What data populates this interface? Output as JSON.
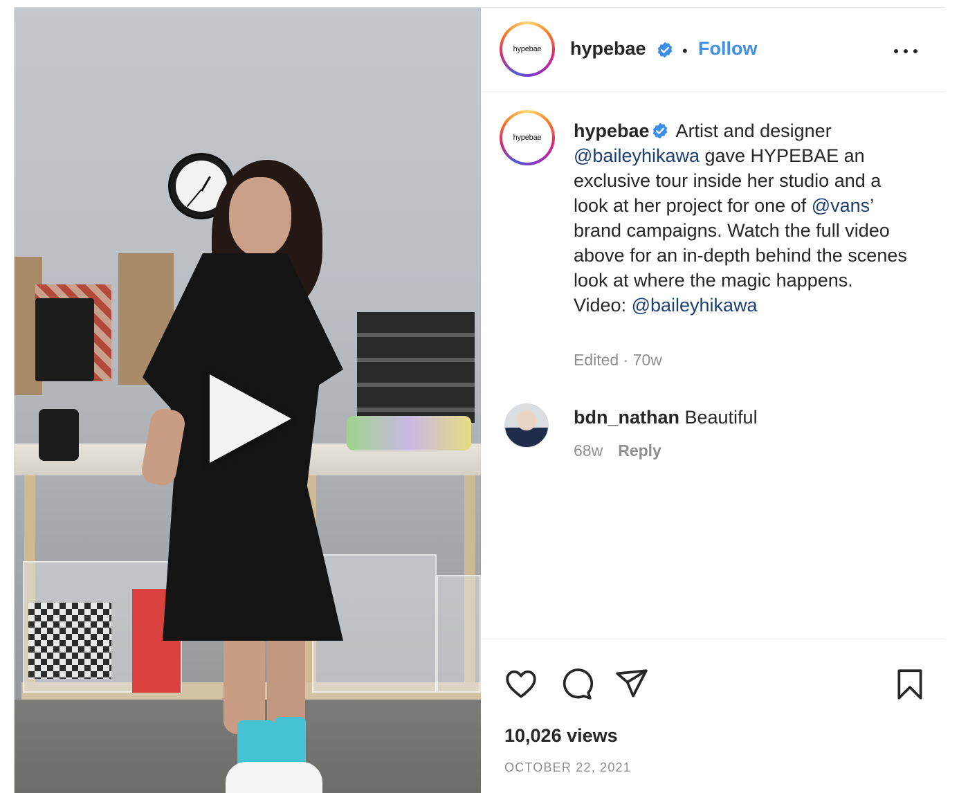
{
  "account": {
    "username": "hypebae",
    "avatar_text": "hypebae",
    "verified": true,
    "follow_label": "Follow",
    "separator": "•"
  },
  "caption": {
    "username": "hypebae",
    "part1": " Artist and designer ",
    "mention1": "@baileyhikawa",
    "part2": " gave HYPEBAE an exclusive tour inside her studio and a look at her project for one of ",
    "mention2": "@vans",
    "part3": "’ brand campaigns. Watch the full video above for an in-depth behind the scenes look at where the magic happens.",
    "part4": "Video: ",
    "mention3": "@baileyhikawa",
    "meta": "Edited · 70w"
  },
  "comments": [
    {
      "username": "bdn_nathan",
      "text": " Beautiful",
      "age": "68w",
      "reply_label": "Reply"
    }
  ],
  "stats": {
    "views": "10,026 views",
    "date": "OCTOBER 22, 2021"
  },
  "icons": {
    "like": "heart-icon",
    "comment": "comment-icon",
    "share": "paper-plane-icon",
    "save": "bookmark-icon",
    "more": "more-options-icon",
    "play": "play-icon",
    "verified": "verified-badge-icon"
  },
  "colors": {
    "accent": "#3d8ee8",
    "mention": "#1d3f73",
    "muted": "#8e8e8e",
    "text": "#262626"
  }
}
